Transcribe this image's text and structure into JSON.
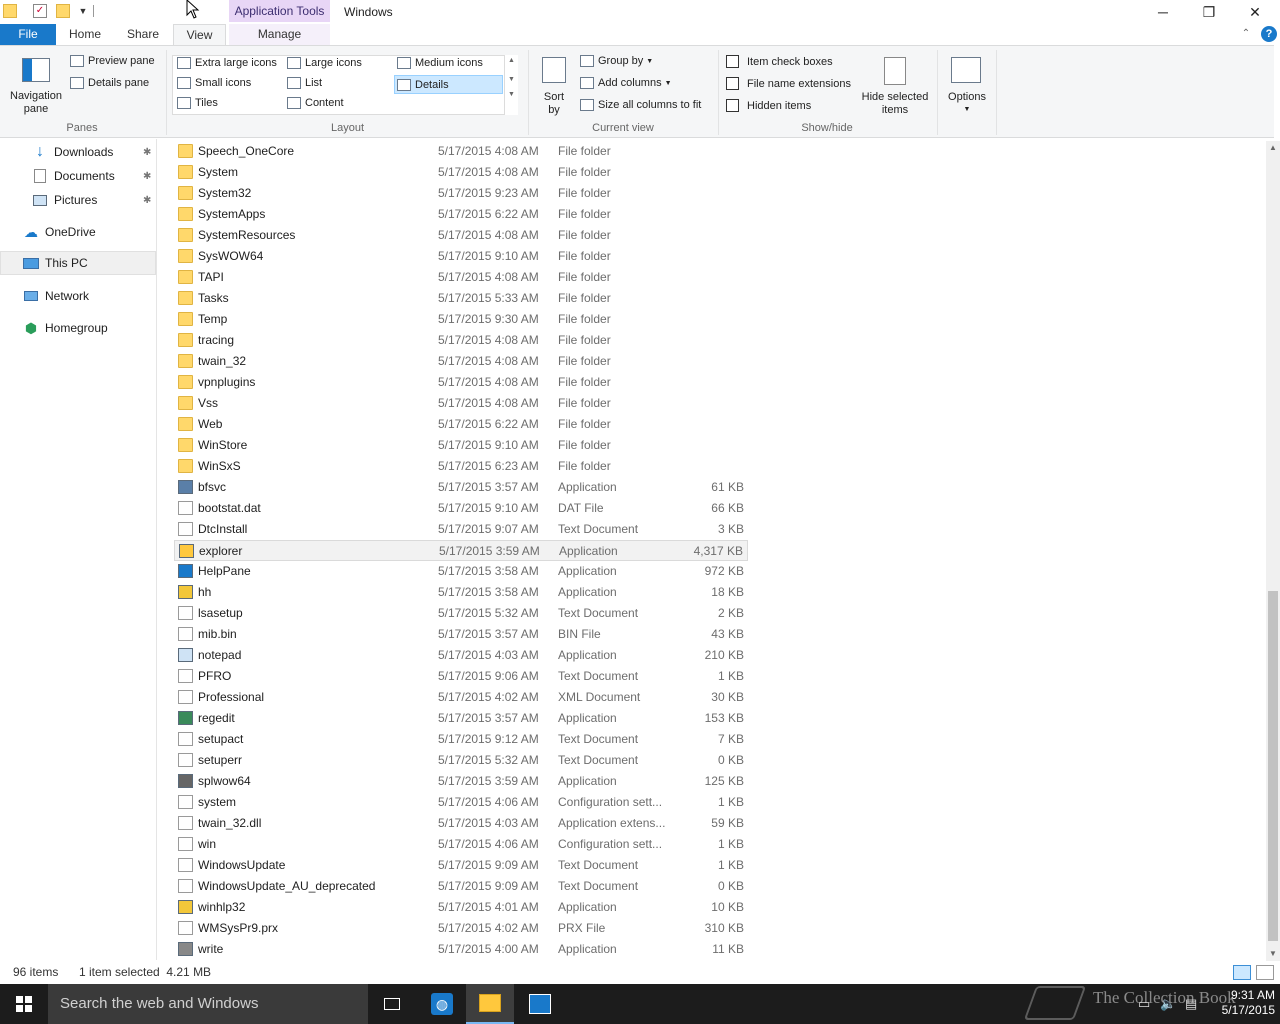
{
  "titlebar": {
    "contextual_tab": "Application Tools",
    "window_title": "Windows",
    "minimize": "─",
    "maximize": "❐",
    "close": "✕"
  },
  "tabs": {
    "file": "File",
    "home": "Home",
    "share": "Share",
    "view": "View",
    "manage": "Manage",
    "help": "?"
  },
  "ribbon": {
    "panes": {
      "group": "Panes",
      "navigation_pane": "Navigation",
      "navigation_pane2": "pane",
      "preview_pane": "Preview pane",
      "details_pane": "Details pane"
    },
    "layout": {
      "group": "Layout",
      "extra_large_icons": "Extra large icons",
      "large_icons": "Large icons",
      "medium_icons": "Medium icons",
      "small_icons": "Small icons",
      "list": "List",
      "details": "Details",
      "tiles": "Tiles",
      "content": "Content"
    },
    "current_view": {
      "group": "Current view",
      "sort_by": "Sort",
      "sort_by2": "by",
      "group_by": "Group by",
      "add_columns": "Add columns",
      "size_all_columns": "Size all columns to fit"
    },
    "show_hide": {
      "group": "Show/hide",
      "item_check_boxes": "Item check boxes",
      "file_name_extensions": "File name extensions",
      "hidden_items": "Hidden items",
      "hide_selected_items": "Hide selected",
      "hide_selected_items2": "items"
    },
    "options": "Options"
  },
  "nav": {
    "downloads": "Downloads",
    "documents": "Documents",
    "pictures": "Pictures",
    "onedrive": "OneDrive",
    "this_pc": "This PC",
    "network": "Network",
    "homegroup": "Homegroup"
  },
  "files": [
    {
      "name": "Speech_OneCore",
      "date": "5/17/2015 4:08 AM",
      "type": "File folder",
      "size": "",
      "icon": "folder"
    },
    {
      "name": "System",
      "date": "5/17/2015 4:08 AM",
      "type": "File folder",
      "size": "",
      "icon": "folder"
    },
    {
      "name": "System32",
      "date": "5/17/2015 9:23 AM",
      "type": "File folder",
      "size": "",
      "icon": "folder"
    },
    {
      "name": "SystemApps",
      "date": "5/17/2015 6:22 AM",
      "type": "File folder",
      "size": "",
      "icon": "folder"
    },
    {
      "name": "SystemResources",
      "date": "5/17/2015 4:08 AM",
      "type": "File folder",
      "size": "",
      "icon": "folder"
    },
    {
      "name": "SysWOW64",
      "date": "5/17/2015 9:10 AM",
      "type": "File folder",
      "size": "",
      "icon": "folder"
    },
    {
      "name": "TAPI",
      "date": "5/17/2015 4:08 AM",
      "type": "File folder",
      "size": "",
      "icon": "folder"
    },
    {
      "name": "Tasks",
      "date": "5/17/2015 5:33 AM",
      "type": "File folder",
      "size": "",
      "icon": "folder"
    },
    {
      "name": "Temp",
      "date": "5/17/2015 9:30 AM",
      "type": "File folder",
      "size": "",
      "icon": "folder"
    },
    {
      "name": "tracing",
      "date": "5/17/2015 4:08 AM",
      "type": "File folder",
      "size": "",
      "icon": "folder"
    },
    {
      "name": "twain_32",
      "date": "5/17/2015 4:08 AM",
      "type": "File folder",
      "size": "",
      "icon": "folder"
    },
    {
      "name": "vpnplugins",
      "date": "5/17/2015 4:08 AM",
      "type": "File folder",
      "size": "",
      "icon": "folder"
    },
    {
      "name": "Vss",
      "date": "5/17/2015 4:08 AM",
      "type": "File folder",
      "size": "",
      "icon": "folder"
    },
    {
      "name": "Web",
      "date": "5/17/2015 6:22 AM",
      "type": "File folder",
      "size": "",
      "icon": "folder"
    },
    {
      "name": "WinStore",
      "date": "5/17/2015 9:10 AM",
      "type": "File folder",
      "size": "",
      "icon": "folder"
    },
    {
      "name": "WinSxS",
      "date": "5/17/2015 6:23 AM",
      "type": "File folder",
      "size": "",
      "icon": "folder"
    },
    {
      "name": "bfsvc",
      "date": "5/17/2015 3:57 AM",
      "type": "Application",
      "size": "61 KB",
      "icon": "app"
    },
    {
      "name": "bootstat.dat",
      "date": "5/17/2015 9:10 AM",
      "type": "DAT File",
      "size": "66 KB",
      "icon": "doc"
    },
    {
      "name": "DtcInstall",
      "date": "5/17/2015 9:07 AM",
      "type": "Text Document",
      "size": "3 KB",
      "icon": "doc"
    },
    {
      "name": "explorer",
      "date": "5/17/2015 3:59 AM",
      "type": "Application",
      "size": "4,317 KB",
      "icon": "explorer",
      "selected": true
    },
    {
      "name": "HelpPane",
      "date": "5/17/2015 3:58 AM",
      "type": "Application",
      "size": "972 KB",
      "icon": "help"
    },
    {
      "name": "hh",
      "date": "5/17/2015 3:58 AM",
      "type": "Application",
      "size": "18 KB",
      "icon": "hh"
    },
    {
      "name": "lsasetup",
      "date": "5/17/2015 5:32 AM",
      "type": "Text Document",
      "size": "2 KB",
      "icon": "doc"
    },
    {
      "name": "mib.bin",
      "date": "5/17/2015 3:57 AM",
      "type": "BIN File",
      "size": "43 KB",
      "icon": "doc"
    },
    {
      "name": "notepad",
      "date": "5/17/2015 4:03 AM",
      "type": "Application",
      "size": "210 KB",
      "icon": "notepad"
    },
    {
      "name": "PFRO",
      "date": "5/17/2015 9:06 AM",
      "type": "Text Document",
      "size": "1 KB",
      "icon": "doc"
    },
    {
      "name": "Professional",
      "date": "5/17/2015 4:02 AM",
      "type": "XML Document",
      "size": "30 KB",
      "icon": "xml"
    },
    {
      "name": "regedit",
      "date": "5/17/2015 3:57 AM",
      "type": "Application",
      "size": "153 KB",
      "icon": "regedit"
    },
    {
      "name": "setupact",
      "date": "5/17/2015 9:12 AM",
      "type": "Text Document",
      "size": "7 KB",
      "icon": "doc"
    },
    {
      "name": "setuperr",
      "date": "5/17/2015 5:32 AM",
      "type": "Text Document",
      "size": "0 KB",
      "icon": "doc"
    },
    {
      "name": "splwow64",
      "date": "5/17/2015 3:59 AM",
      "type": "Application",
      "size": "125 KB",
      "icon": "printer"
    },
    {
      "name": "system",
      "date": "5/17/2015 4:06 AM",
      "type": "Configuration sett...",
      "size": "1 KB",
      "icon": "config"
    },
    {
      "name": "twain_32.dll",
      "date": "5/17/2015 4:03 AM",
      "type": "Application extens...",
      "size": "59 KB",
      "icon": "dll"
    },
    {
      "name": "win",
      "date": "5/17/2015 4:06 AM",
      "type": "Configuration sett...",
      "size": "1 KB",
      "icon": "config"
    },
    {
      "name": "WindowsUpdate",
      "date": "5/17/2015 9:09 AM",
      "type": "Text Document",
      "size": "1 KB",
      "icon": "doc"
    },
    {
      "name": "WindowsUpdate_AU_deprecated",
      "date": "5/17/2015 9:09 AM",
      "type": "Text Document",
      "size": "0 KB",
      "icon": "doc"
    },
    {
      "name": "winhlp32",
      "date": "5/17/2015 4:01 AM",
      "type": "Application",
      "size": "10 KB",
      "icon": "winhlp"
    },
    {
      "name": "WMSysPr9.prx",
      "date": "5/17/2015 4:02 AM",
      "type": "PRX File",
      "size": "310 KB",
      "icon": "doc"
    },
    {
      "name": "write",
      "date": "5/17/2015 4:00 AM",
      "type": "Application",
      "size": "11 KB",
      "icon": "write"
    }
  ],
  "status": {
    "item_count": "96 items",
    "selection": "1 item selected  4.21 MB"
  },
  "taskbar": {
    "search_placeholder": "Search the web and Windows",
    "time": "9:31 AM",
    "date": "5/17/2015",
    "watermark": "The Collection Book"
  }
}
